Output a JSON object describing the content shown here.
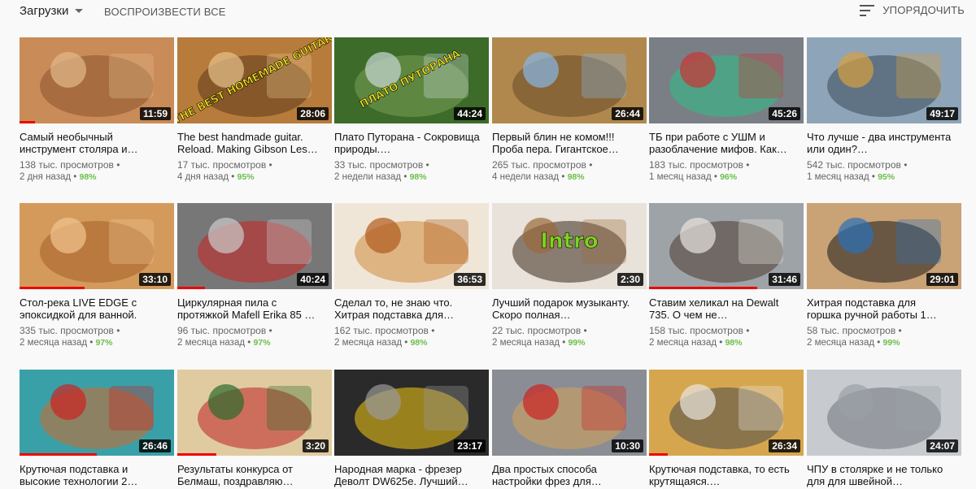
{
  "header": {
    "uploads_label": "Загрузки",
    "play_all_label": "ВОСПРОИЗВЕСТИ ВСЕ",
    "sort_label": "УПОРЯДОЧИТЬ"
  },
  "videos": [
    {
      "title": "Самый необычный инструмент столяра и…",
      "duration": "11:59",
      "views": "138 тыс. просмотров",
      "age": "2 дня назад",
      "rating": "98%",
      "progress": 0.1,
      "theme": "wood",
      "overlay": ""
    },
    {
      "title": "The best handmade guitar. Reload. Making Gibson Les…",
      "duration": "28:06",
      "views": "17 тыс. просмотров",
      "age": "4 дня назад",
      "rating": "95%",
      "progress": 0,
      "theme": "guitar",
      "overlay": "THE BEST HOMEMADE GUITAR"
    },
    {
      "title": "Плато Путорана - Сокровища природы.…",
      "duration": "44:24",
      "views": "33 тыс. просмотров",
      "age": "2 недели назад",
      "rating": "98%",
      "progress": 0,
      "theme": "nature",
      "overlay": "ПЛАТО ПУТОРАНА"
    },
    {
      "title": "Первый блин не комом!!! Проба пера. Гигантское…",
      "duration": "26:44",
      "views": "265 тыс. просмотров",
      "age": "4 недели назад",
      "rating": "98%",
      "progress": 0,
      "theme": "bowl",
      "overlay": ""
    },
    {
      "title": "ТБ при работе с УШМ и разоблачение мифов. Как…",
      "duration": "45:26",
      "views": "183 тыс. просмотров",
      "age": "1 месяц назад",
      "rating": "96%",
      "progress": 0,
      "theme": "discs",
      "overlay": ""
    },
    {
      "title": "Что лучше - два инструмента или один?…",
      "duration": "49:17",
      "views": "542 тыс. просмотров",
      "age": "1 месяц назад",
      "rating": "95%",
      "progress": 0,
      "theme": "saw",
      "overlay": ""
    },
    {
      "title": "Стол-река LIVE EDGE с эпоксидкой для ванной.",
      "duration": "33:10",
      "views": "335 тыс. просмотров",
      "age": "2 месяца назад",
      "rating": "97%",
      "progress": 0.42,
      "theme": "slab",
      "overlay": ""
    },
    {
      "title": "Циркулярная пила с протяжкой Mafell Erika 85 …",
      "duration": "40:24",
      "views": "96 тыс. просмотров",
      "age": "2 месяца назад",
      "rating": "97%",
      "progress": 0.18,
      "theme": "table",
      "overlay": ""
    },
    {
      "title": "Сделал то, не знаю что. Хитрая подставка для…",
      "duration": "36:53",
      "views": "162 тыс. просмотров",
      "age": "2 месяца назад",
      "rating": "98%",
      "progress": 0,
      "theme": "petals",
      "overlay": ""
    },
    {
      "title": "Лучший подарок музыканту. Скоро полная…",
      "duration": "2:30",
      "views": "22 тыс. просмотров",
      "age": "2 месяца назад",
      "rating": "99%",
      "progress": 0,
      "theme": "intro",
      "overlay": "Intro"
    },
    {
      "title": "Ставим хеликал на Dewalt 735. О чем не…",
      "duration": "31:46",
      "views": "158 тыс. просмотров",
      "age": "2 месяца назад",
      "rating": "98%",
      "progress": 0.7,
      "theme": "shop",
      "overlay": ""
    },
    {
      "title": "Хитрая подставка для горшка ручной работы 1…",
      "duration": "29:01",
      "views": "58 тыс. просмотров",
      "age": "2 месяца назад",
      "rating": "99%",
      "progress": 0,
      "theme": "glue",
      "overlay": ""
    },
    {
      "title": "Крутючая подставка и высокие технологии 2…",
      "duration": "26:46",
      "views": "",
      "age": "",
      "rating": "",
      "progress": 0.5,
      "theme": "lazy",
      "overlay": ""
    },
    {
      "title": "Результаты конкурса от Белмаш, поздравляю…",
      "duration": "3:20",
      "views": "",
      "age": "",
      "rating": "",
      "progress": 0.25,
      "theme": "vase",
      "overlay": ""
    },
    {
      "title": "Народная марка - фрезер Деволт DW625е. Лучший…",
      "duration": "23:17",
      "views": "",
      "age": "",
      "rating": "",
      "progress": 0,
      "theme": "router",
      "overlay": ""
    },
    {
      "title": "Два простых способа настройки фрез для…",
      "duration": "10:30",
      "views": "",
      "age": "",
      "rating": "",
      "progress": 0,
      "theme": "jig",
      "overlay": ""
    },
    {
      "title": "Крутючая подставка, то есть крутящаяся.…",
      "duration": "26:34",
      "views": "",
      "age": "",
      "rating": "",
      "progress": 0.12,
      "theme": "lathe",
      "overlay": ""
    },
    {
      "title": "ЧПУ в столярке и не только для для швейной…",
      "duration": "24:07",
      "views": "",
      "age": "",
      "rating": "",
      "progress": 0,
      "theme": "plate",
      "overlay": ""
    }
  ]
}
